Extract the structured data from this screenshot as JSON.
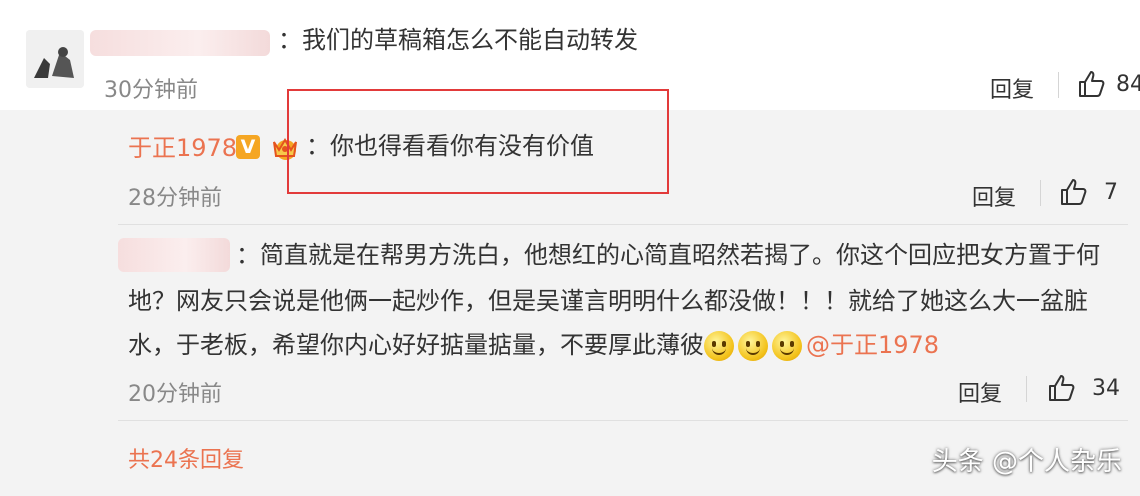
{
  "comment1": {
    "text": "：我们的草稿箱怎么不能自动转发",
    "time": "30分钟前",
    "reply": "回复",
    "likes": "84"
  },
  "reply1": {
    "author": "于正1978",
    "badge": "V",
    "text": "：你也得看看你有没有价值",
    "time": "28分钟前",
    "reply": "回复",
    "likes": "7"
  },
  "reply2": {
    "line1": "：简直就是在帮男方洗白，他想红的心简直昭然若揭了。你这个回应把女方置于何",
    "line2": "地？网友只会说是他俩一起炒作，但是吴谨言明明什么都没做！！！就给了她这么大一盆脏",
    "line3_text": "水，于老板，希望你内心好好掂量掂量，不要厚此薄彼",
    "mention": "@于正1978",
    "time": "20分钟前",
    "reply": "回复",
    "likes": "34"
  },
  "footer": {
    "total_replies": "共24条回复"
  },
  "watermark": "头条 @个人杂乐",
  "colors": {
    "accent": "#eb7350",
    "highlight": "#e23a3a",
    "badge": "#f5a623"
  }
}
